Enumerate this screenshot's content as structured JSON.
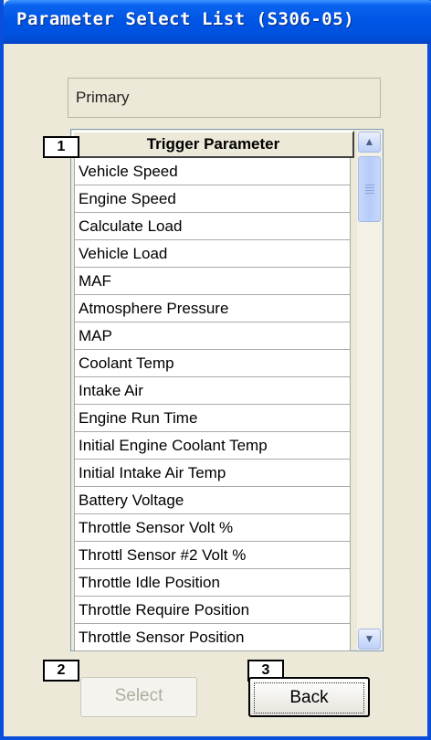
{
  "window": {
    "title": "Parameter Select List (S306-05)"
  },
  "primary": {
    "label": "Primary"
  },
  "list": {
    "header": "Trigger Parameter",
    "items": [
      "Vehicle Speed",
      "Engine Speed",
      "Calculate Load",
      "Vehicle Load",
      "MAF",
      "Atmosphere Pressure",
      "MAP",
      "Coolant Temp",
      "Intake Air",
      "Engine Run Time",
      "Initial Engine Coolant Temp",
      "Initial Intake Air Temp",
      "Battery Voltage",
      "Throttle Sensor Volt %",
      "Throttl Sensor #2 Volt %",
      "Throttle Idle Position",
      "Throttle Require Position",
      "Throttle Sensor Position"
    ]
  },
  "scrollbar": {
    "up_icon": "▲",
    "down_icon": "▼"
  },
  "callouts": {
    "one": "1",
    "two": "2",
    "three": "3"
  },
  "buttons": {
    "select": "Select",
    "back": "Back"
  }
}
